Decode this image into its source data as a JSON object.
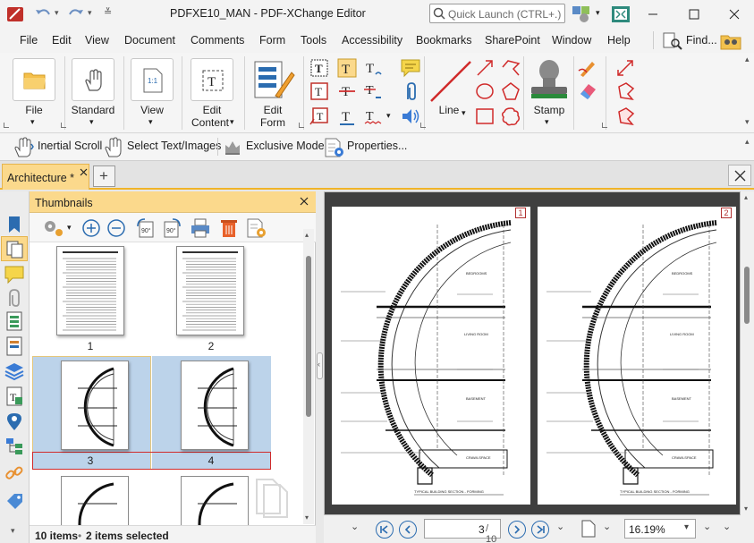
{
  "window": {
    "title": "PDFXE10_MAN - PDF-XChange Editor",
    "quick_launch_placeholder": "Quick Launch (CTRL+.)"
  },
  "menu": {
    "items": [
      "File",
      "Edit",
      "View",
      "Document",
      "Comments",
      "Form",
      "Tools",
      "Accessibility",
      "Bookmarks",
      "SharePoint",
      "Window",
      "Help"
    ],
    "find_label": "Find..."
  },
  "ribbon": {
    "file": "File",
    "standard": "Standard",
    "view": "View",
    "edit_content_1": "Edit",
    "edit_content_2": "Content",
    "edit_form_1": "Edit",
    "edit_form_2": "Form",
    "line": "Line",
    "stamp": "Stamp"
  },
  "toolbar2": {
    "inertial_scroll": "Inertial Scroll",
    "select_text_images": "Select Text/Images",
    "exclusive_mode": "Exclusive Mode",
    "properties": "Properties..."
  },
  "tabs": {
    "active_label": "Architecture *",
    "add_label": "+"
  },
  "thumbnails": {
    "header": "Thumbnails",
    "pages": [
      "1",
      "2",
      "3",
      "4"
    ],
    "status_items": "10 items",
    "status_sep": "•",
    "status_selected": "2 items selected"
  },
  "document": {
    "page_labels": [
      "1",
      "2"
    ],
    "rooms": [
      "BEDROOMS",
      "LIVING ROOM",
      "BASEMENT",
      "CRAWLSPACE"
    ],
    "section_title": "TYPICAL BUILDING SECTION - FORMING"
  },
  "navigation": {
    "current_page": "3",
    "total_pages": "/ 10",
    "zoom": "16.19%"
  },
  "colors": {
    "accent": "#fbd98c",
    "accent_border": "#f0b429",
    "selection_fill": "#bcd3ea",
    "nav_blue": "#2b6cb0",
    "markup_red": "#d02a2a"
  }
}
